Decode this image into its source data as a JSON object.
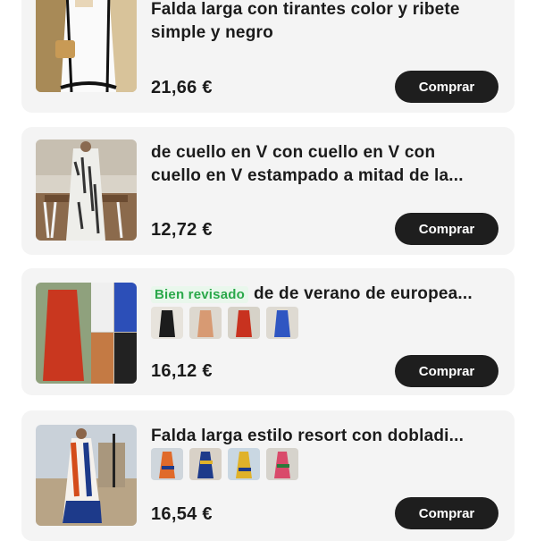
{
  "products": [
    {
      "title_lines": [
        "Falda larga con tirantes color y ribete",
        "simple y negro"
      ],
      "price": "21,66 €",
      "button": "Comprar",
      "image": "dress-white-black-trim"
    },
    {
      "title_lines": [
        "de cuello en V con cuello en V con",
        "cuello en V estampado a mitad de la..."
      ],
      "price": "12,72 €",
      "button": "Comprar",
      "image": "dress-tie-dye-print"
    },
    {
      "badge": "Bien revisado",
      "title_single": "de de verano de europea...",
      "price": "16,12 €",
      "button": "Comprar",
      "image": "dress-colors-collage",
      "variants": [
        "black",
        "beige",
        "red",
        "blue"
      ]
    },
    {
      "title_single": "Falda larga estilo resort con dobladi...",
      "price": "16,54 €",
      "button": "Comprar",
      "image": "dress-resort-print",
      "variants": [
        "print-orange",
        "print-blue",
        "print-yellow",
        "print-red"
      ]
    }
  ]
}
